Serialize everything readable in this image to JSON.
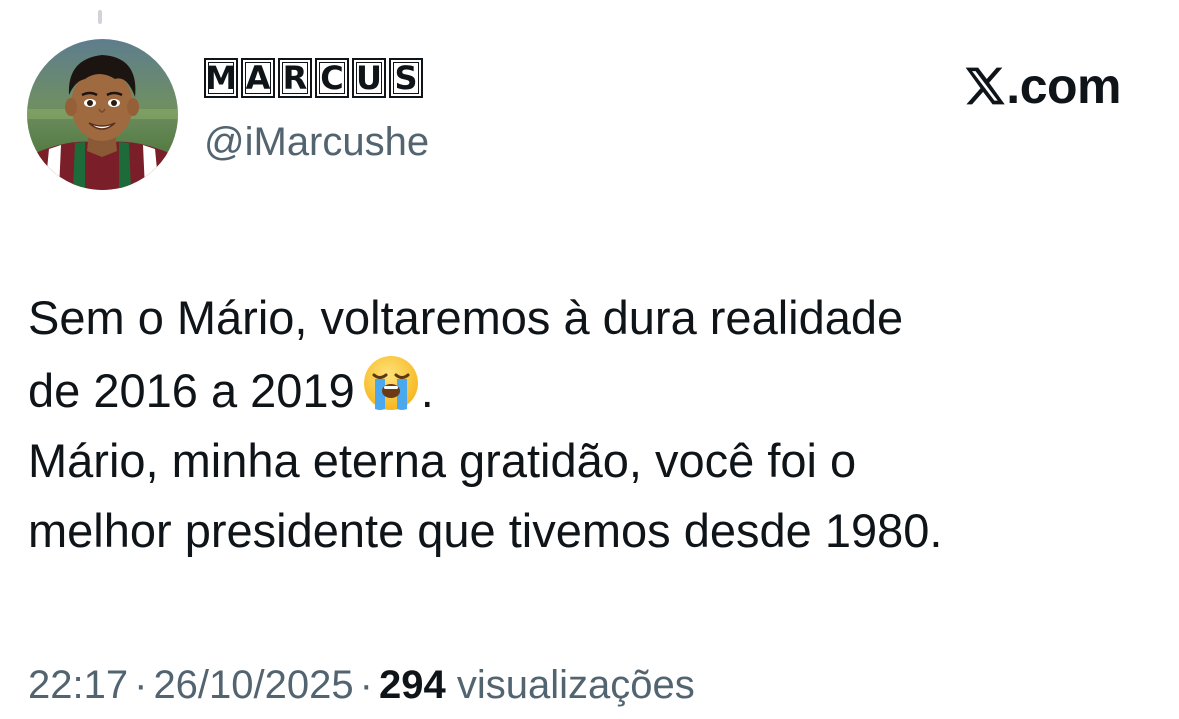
{
  "author": {
    "display_name_letters": [
      "M",
      "A",
      "R",
      "C",
      "U",
      "S"
    ],
    "handle": "@iMarcushe"
  },
  "header": {
    "site_label": ".com",
    "site_logo_icon": "x-logo-icon"
  },
  "tweet": {
    "line1": "Sem o Mário, voltaremos à dura realidade",
    "line2_text": "de 2016 a 2019",
    "line2_emoji": "loudly-crying-face-icon",
    "line2_end": ".",
    "line3": "Mário, minha eterna gratidão, você foi o",
    "line4": "melhor presidente que tivemos desde 1980."
  },
  "meta": {
    "time": "22:17",
    "separator": "·",
    "date": "26/10/2025",
    "views_count": "294",
    "views_label": "visualizações"
  },
  "colors": {
    "text_primary": "#0f1419",
    "text_secondary": "#536471",
    "background": "#ffffff"
  }
}
